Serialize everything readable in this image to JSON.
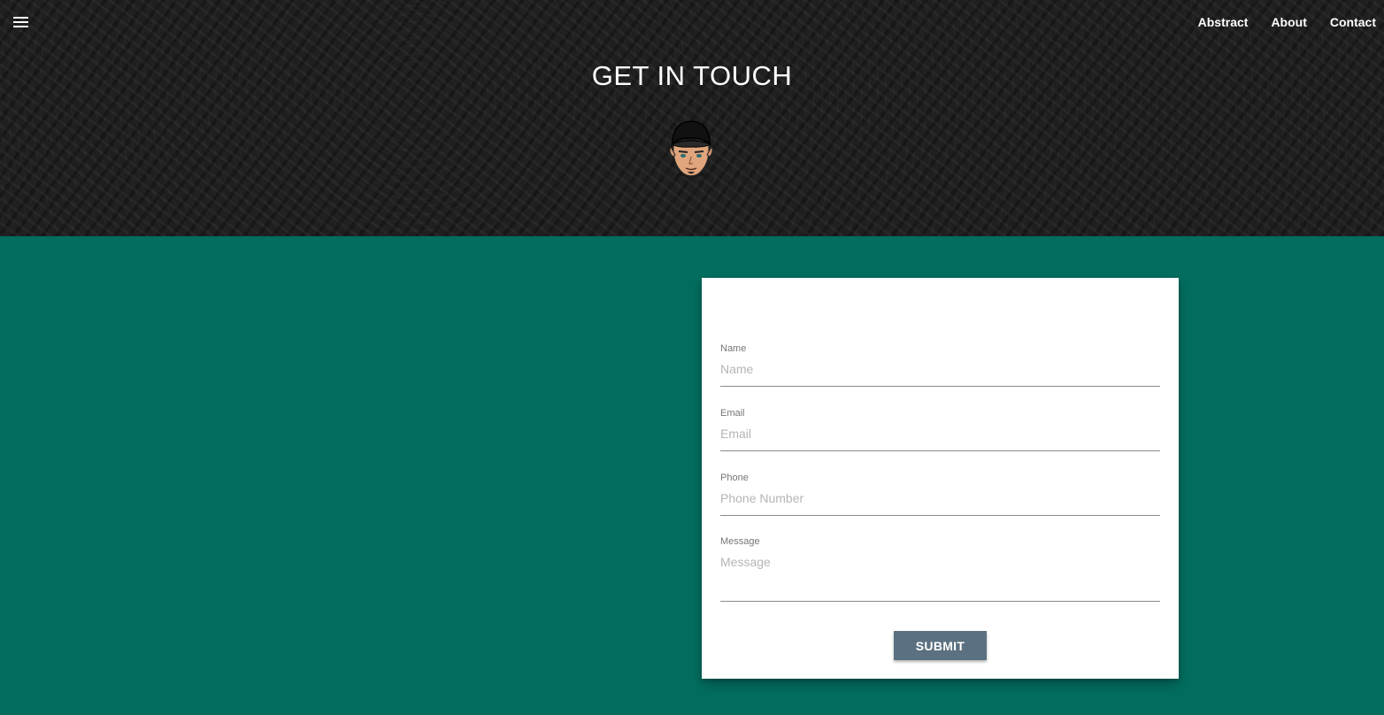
{
  "nav": {
    "menu_icon": "hamburger-menu-icon",
    "links": [
      "Abstract",
      "About",
      "Contact"
    ]
  },
  "hero": {
    "title": "GET IN TOUCH",
    "avatar_icon": "cartoon-avatar-with-cap"
  },
  "form": {
    "name": {
      "label": "Name",
      "placeholder": "Name",
      "value": ""
    },
    "email": {
      "label": "Email",
      "placeholder": "Email",
      "value": ""
    },
    "phone": {
      "label": "Phone",
      "placeholder": "Phone Number",
      "value": ""
    },
    "message": {
      "label": "Message",
      "placeholder": "Message",
      "value": ""
    },
    "submit_label": "SUBMIT"
  },
  "colors": {
    "page_background": "#036e5f",
    "hero_background": "#1f1f1f",
    "submit_button": "#5b7181",
    "card_background": "#ffffff"
  }
}
